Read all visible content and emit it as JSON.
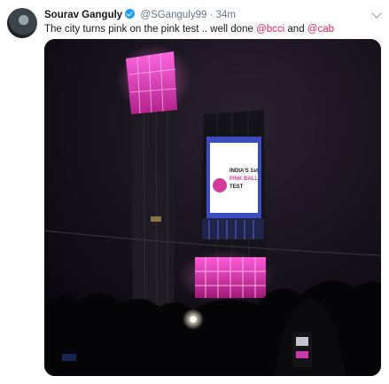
{
  "tweet": {
    "author_name": "Sourav Ganguly",
    "author_handle": "@SGanguly99",
    "separator": "·",
    "time": "34m",
    "text_part1": "The city turns pink on the pink test .. well done ",
    "mention1": "@bcci",
    "text_part2": " and ",
    "mention2": "@cab",
    "image_screen_text": {
      "line1": "INDIA'S 1st",
      "line2": "PINK BALL",
      "line3": "TEST"
    }
  },
  "icons": {
    "verified": "verified-badge-icon",
    "more": "chevron-down-icon"
  },
  "colors": {
    "mention": "#e0245e",
    "verified": "#1da1f2",
    "name": "#14171a",
    "secondary": "#657786",
    "pink_light": "#e040c0"
  }
}
